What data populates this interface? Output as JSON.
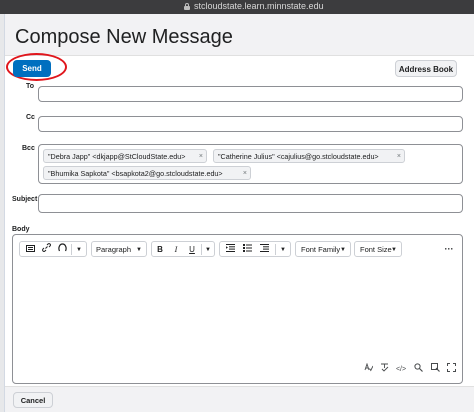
{
  "browser": {
    "url": "stcloudstate.learn.minnstate.edu"
  },
  "dialog": {
    "title": "Compose New Message"
  },
  "toolbar": {
    "send_label": "Send",
    "address_book_label": "Address Book"
  },
  "fields": {
    "to_label": "To",
    "cc_label": "Cc",
    "bcc_label": "Bcc",
    "subject_label": "Subject",
    "body_label": "Body",
    "to_value": "",
    "cc_value": "",
    "subject_value": ""
  },
  "bcc_recipients": [
    {
      "text": "\"Debra Japp\" <dkjapp@StCloudState.edu>"
    },
    {
      "text": "\"Catherine Julius\" <cajulius@go.stcloudstate.edu>"
    },
    {
      "text": "\"Bhumika Sapkota\" <bsapkota2@go.stcloudstate.edu>"
    }
  ],
  "editor_toolbar": {
    "paragraph_label": "Paragraph",
    "bold_label": "B",
    "italic_label": "I",
    "underline_label": "U",
    "font_family_label": "Font Family",
    "font_size_label": "Font Size",
    "more_label": "···",
    "remove_label": "×"
  },
  "footer": {
    "cancel_label": "Cancel"
  },
  "colors": {
    "primary": "#006fbf",
    "highlight_circle": "#e0161c",
    "border": "#8e9095"
  },
  "icons": [
    "lock-icon",
    "insert-stuff-icon",
    "insert-link-icon",
    "emoticon-icon",
    "chevron-down-icon",
    "align-icon",
    "bullet-list-icon",
    "accessibility-check-icon",
    "spell-check-icon",
    "source-code-icon",
    "zoom-preview-icon",
    "fullscreen-icon"
  ]
}
